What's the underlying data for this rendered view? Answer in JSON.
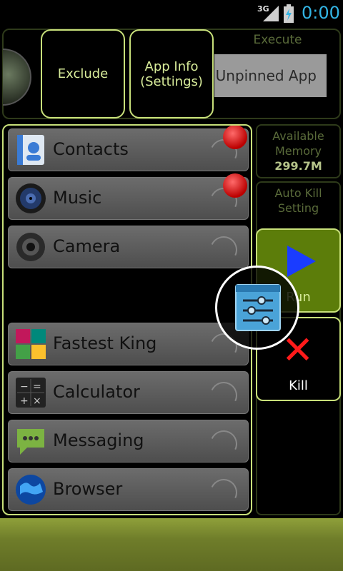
{
  "status_bar": {
    "network": "3G",
    "time": "0:00"
  },
  "top_panel": {
    "exclude_label": "Exclude",
    "app_info_label": "App Info\n(Settings)",
    "execute_label": "Execute",
    "unpinned_label": "l Unpinned App"
  },
  "memory": {
    "label": "Available Memory",
    "value": "299.7M"
  },
  "auto_kill": {
    "label": "Auto Kill Setting"
  },
  "run": {
    "label": "Run"
  },
  "kill": {
    "label": "Kill"
  },
  "apps": [
    {
      "label": "Contacts",
      "icon": "contacts-icon",
      "pinned": true
    },
    {
      "label": "Music",
      "icon": "music-icon",
      "pinned": true
    },
    {
      "label": "Camera",
      "icon": "camera-icon",
      "pinned": false
    },
    {
      "label": "Fastest King",
      "icon": "fastest-king-icon",
      "pinned": true
    },
    {
      "label": "Calculator",
      "icon": "calculator-icon",
      "pinned": false
    },
    {
      "label": "Messaging",
      "icon": "messaging-icon",
      "pinned": false
    },
    {
      "label": "Browser",
      "icon": "browser-icon",
      "pinned": false
    }
  ],
  "colors": {
    "accent": "#c8e07a",
    "clock": "#33b5e5",
    "run_bg": "#5c7d0a",
    "kill_x": "#ff1a1a",
    "play": "#1a3cff"
  }
}
